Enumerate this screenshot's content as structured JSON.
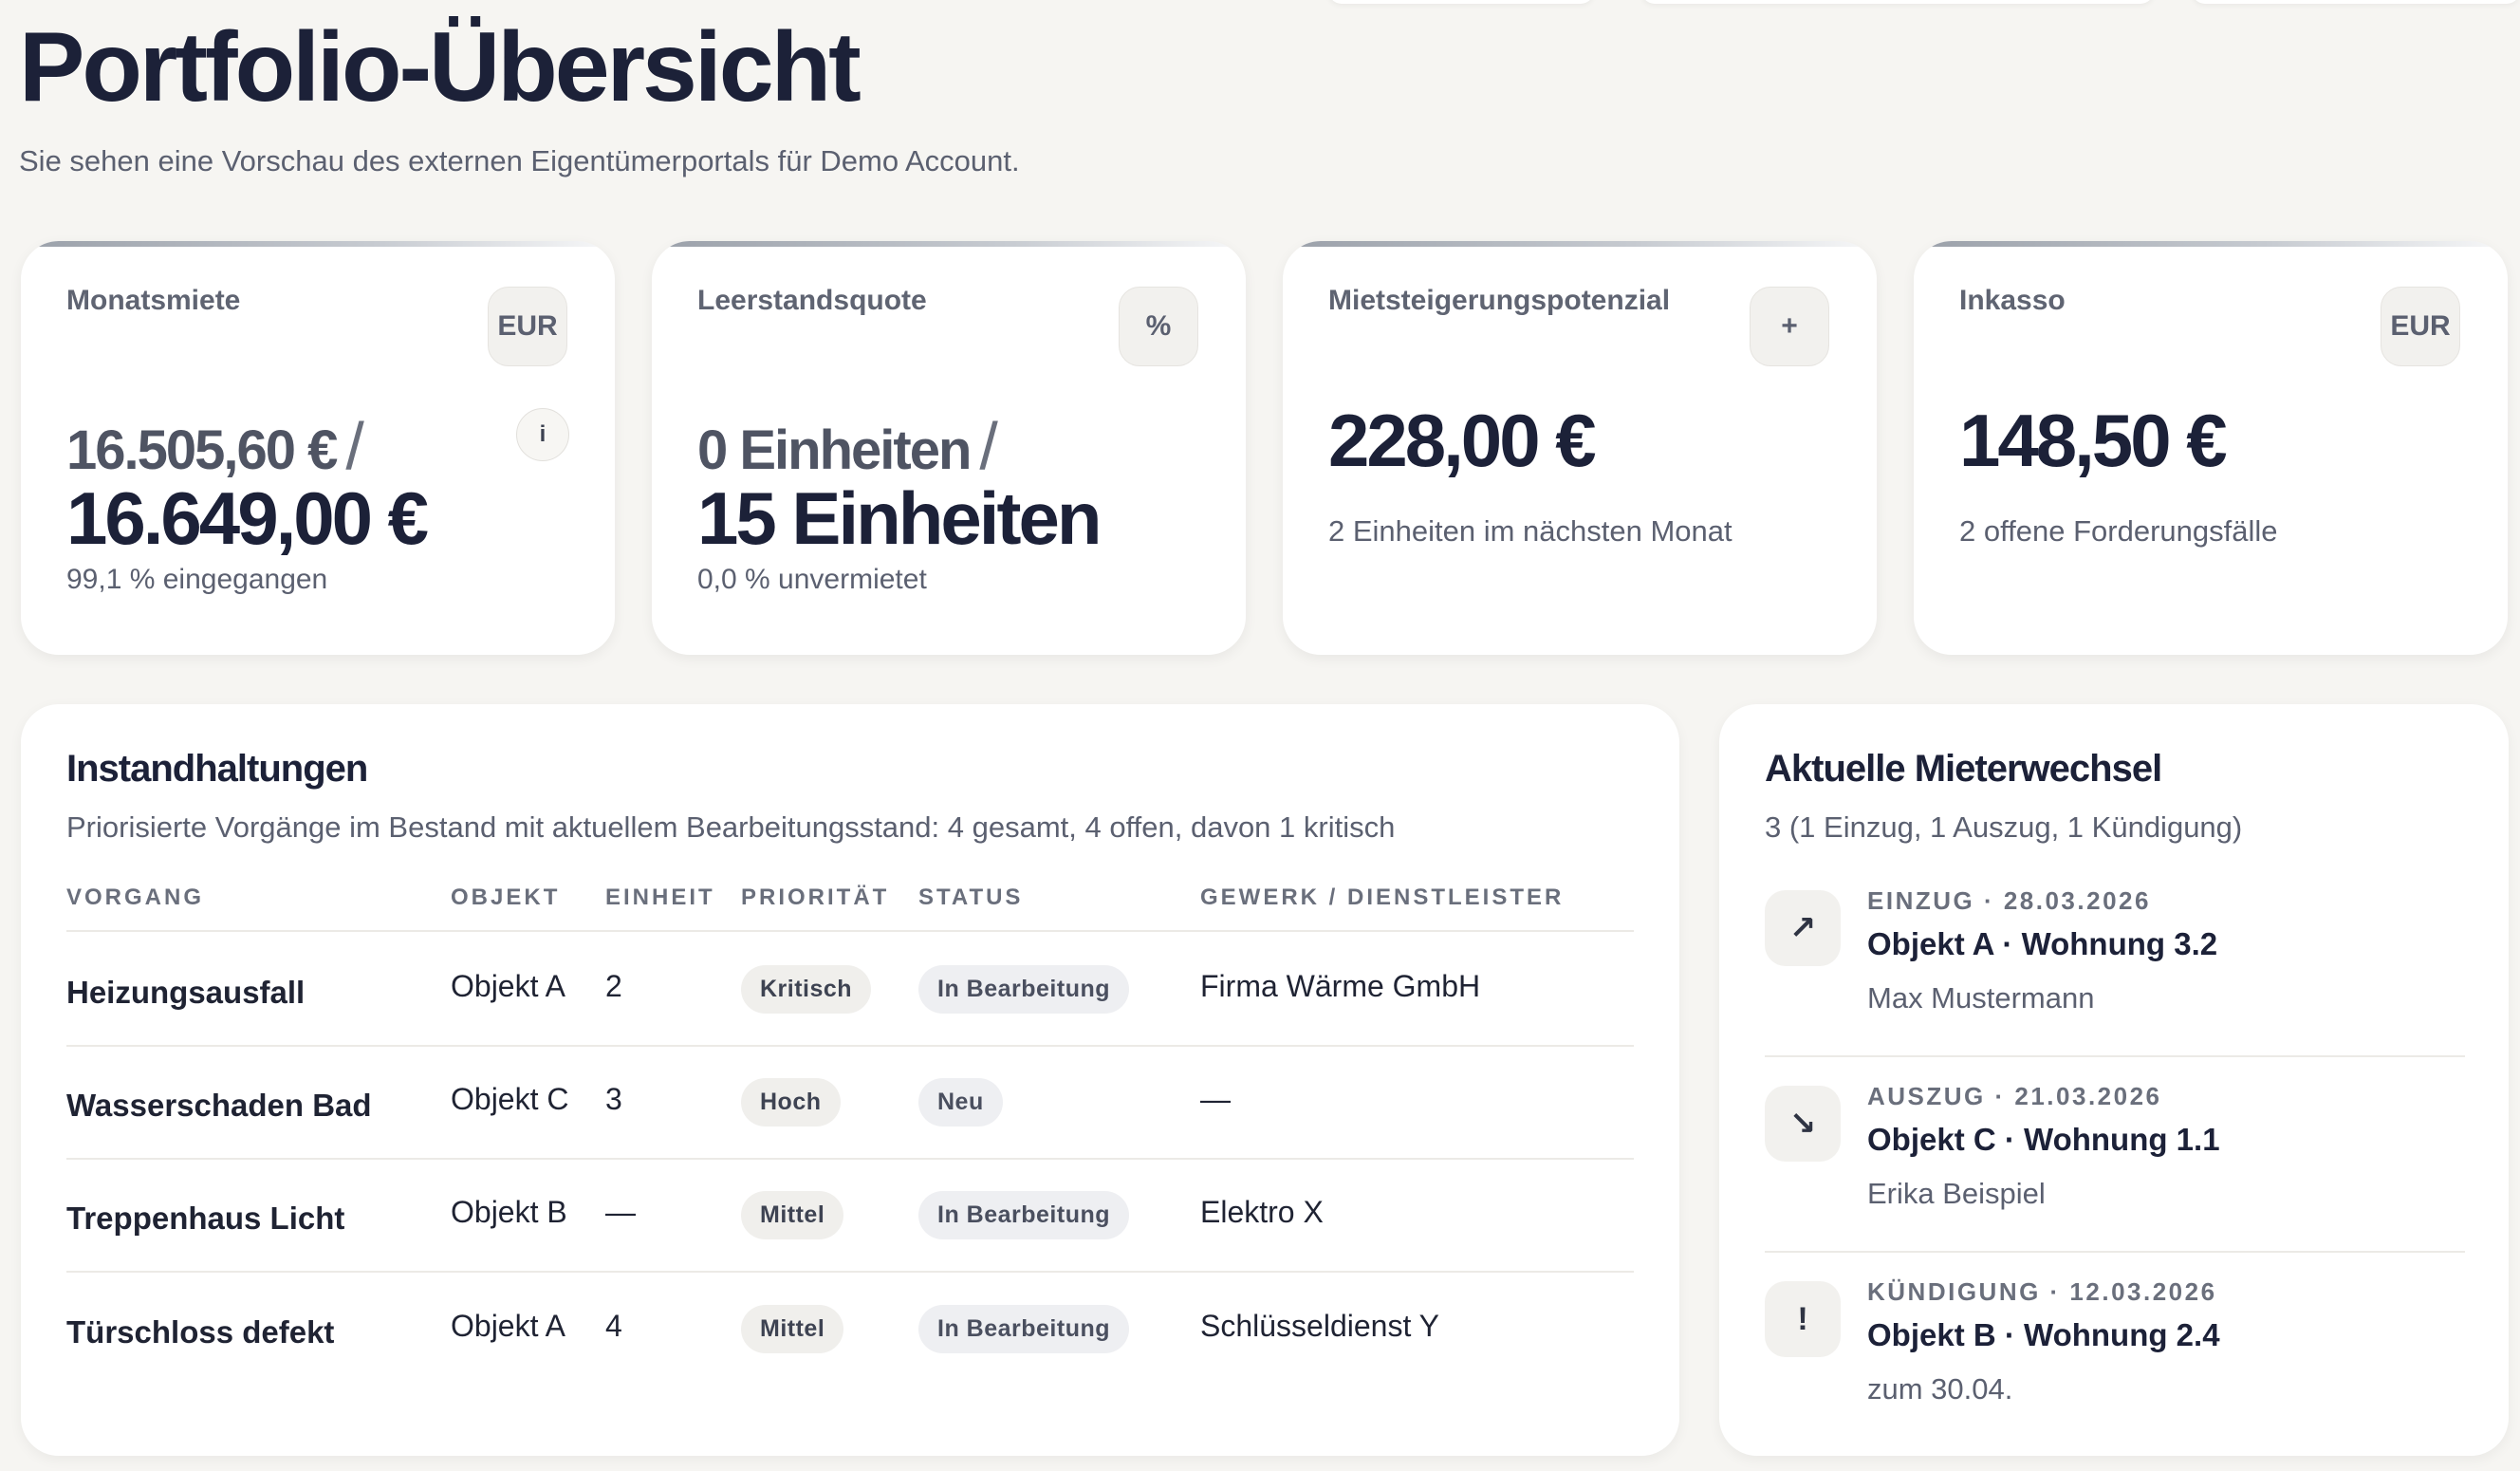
{
  "header": {
    "title": "Portfolio-Übersicht",
    "subtitle": "Sie sehen eine Vorschau des externen Eigentümerportals für Demo Account."
  },
  "kpis": {
    "rent": {
      "label": "Monatsmiete",
      "unit": "EUR",
      "received": "16.505,60 €",
      "slash": "/",
      "target": "16.649,00 €",
      "note": "99,1 % eingegangen",
      "info": "i"
    },
    "vacancy": {
      "label": "Leerstandsquote",
      "unit": "%",
      "vacant": "0 Einheiten",
      "slash": "/",
      "total": "15 Einheiten",
      "note": "0,0 % unvermietet"
    },
    "potential": {
      "label": "Mietsteigerungspotenzial",
      "unit": "+",
      "value": "228,00 €",
      "note": "2 Einheiten im nächsten Monat"
    },
    "collection": {
      "label": "Inkasso",
      "unit": "EUR",
      "value": "148,50 €",
      "note": "2 offene Forderungsfälle"
    }
  },
  "maintenance": {
    "title": "Instandhaltungen",
    "description": "Priorisierte Vorgänge im Bestand mit aktuellem Bearbeitungsstand: 4 gesamt, 4 offen, davon 1 kritisch",
    "columns": [
      "Vorgang",
      "Objekt",
      "Einheit",
      "Priorität",
      "Status",
      "Gewerk / Dienstleister"
    ],
    "rows": [
      {
        "name": "Heizungsausfall",
        "object": "Objekt A",
        "unit": "2",
        "priority": "Kritisch",
        "status": "In Bearbeitung",
        "vendor": "Firma Wärme GmbH"
      },
      {
        "name": "Wasserschaden Bad",
        "object": "Objekt C",
        "unit": "3",
        "priority": "Hoch",
        "status": "Neu",
        "vendor": "—"
      },
      {
        "name": "Treppenhaus Licht",
        "object": "Objekt B",
        "unit": "—",
        "priority": "Mittel",
        "status": "In Bearbeitung",
        "vendor": "Elektro X"
      },
      {
        "name": "Türschloss defekt",
        "object": "Objekt A",
        "unit": "4",
        "priority": "Mittel",
        "status": "In Bearbeitung",
        "vendor": "Schlüsseldienst Y"
      }
    ]
  },
  "tenant_changes": {
    "title": "Aktuelle Mieterwechsel",
    "summary": "3 (1 Einzug, 1 Auszug, 1 Kündigung)",
    "items": [
      {
        "icon": "arrow-up-right-icon",
        "glyph": "↗",
        "meta": "EINZUG · 28.03.2026",
        "object": "Objekt A · Wohnung 3.2",
        "detail": "Max Mustermann"
      },
      {
        "icon": "arrow-down-right-icon",
        "glyph": "↘",
        "meta": "AUSZUG · 21.03.2026",
        "object": "Objekt C · Wohnung 1.1",
        "detail": "Erika Beispiel"
      },
      {
        "icon": "exclamation-icon",
        "glyph": "!",
        "meta": "KÜNDIGUNG · 12.03.2026",
        "object": "Objekt B · Wohnung 2.4",
        "detail": "zum 30.04."
      }
    ]
  }
}
